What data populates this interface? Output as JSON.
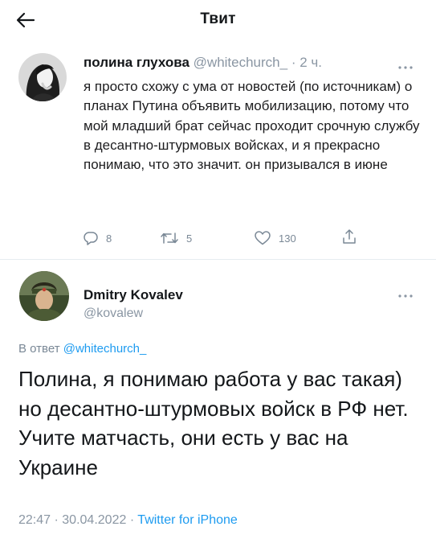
{
  "header": {
    "title": "Твит",
    "back_icon": "arrow-left-icon"
  },
  "tweet1": {
    "author_name": "полина глухова",
    "handle": "@whitechurch_",
    "separator": "·",
    "time": "2 ч.",
    "text": "я просто схожу с ума от новостей (по источникам) о планах Путина объявить мобилизацию, потому что мой младший брат сейчас проходит срочную службу в десантно-штурмовых войсках, и я прекрасно понимаю, что это значит. он призывался в июне",
    "replies": "8",
    "retweets": "5",
    "likes": "130",
    "icons": [
      "reply-icon",
      "retweet-icon",
      "like-icon",
      "share-icon",
      "more-icon"
    ]
  },
  "tweet2": {
    "author_name": "Dmitry Kovalev",
    "handle": "@kovalew",
    "reply_prefix": "В ответ",
    "reply_handle": "@whitechurch_",
    "text": "Полина, я понимаю работа у вас такая) но десантно-штурмовых войск в РФ нет. Учите матчасть, они есть у вас на Украине",
    "time": "22:47",
    "sep1": "·",
    "date": "30.04.2022",
    "sep2": "·",
    "source": "Twitter for iPhone"
  },
  "colors": {
    "link": "#1d9bf0",
    "muted": "#8a96a3",
    "text": "#14171a",
    "divider": "#e6ecf0"
  }
}
